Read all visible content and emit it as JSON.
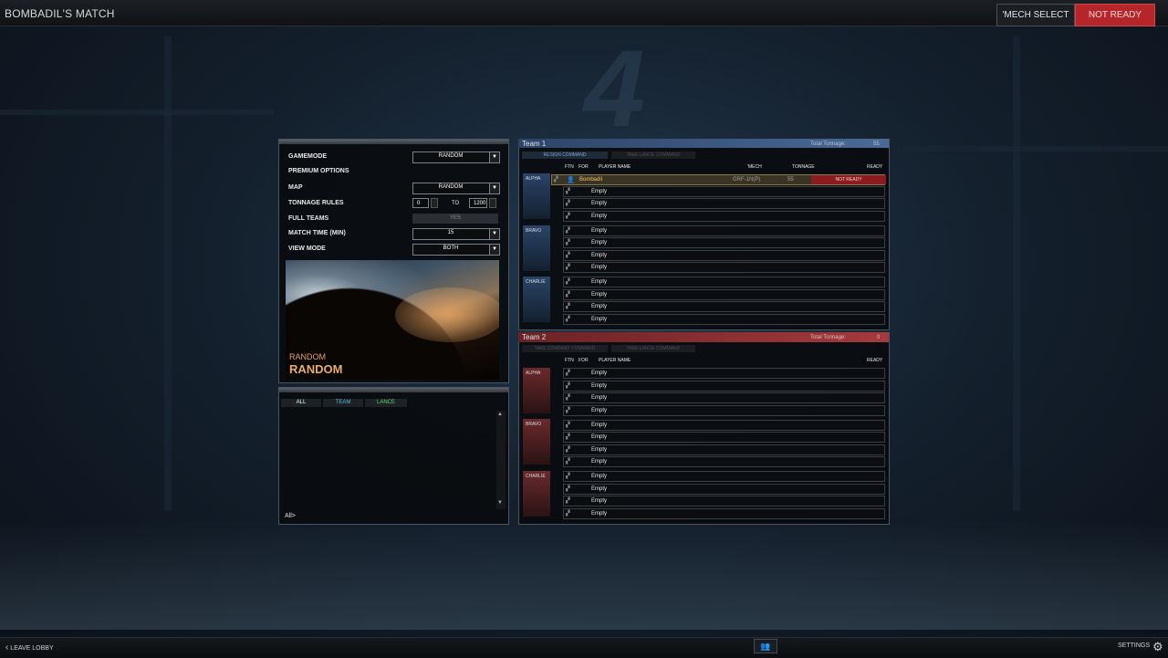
{
  "header": {
    "match_title": "BOMBADIL'S MATCH",
    "mech_select_label": "'MECH SELECT",
    "not_ready_label": "NOT READY"
  },
  "settings": {
    "gamemode_label": "GAMEMODE",
    "gamemode_value": "RANDOM",
    "premium_label": "PREMIUM OPTIONS",
    "map_label": "MAP",
    "map_value": "RANDOM",
    "tonnage_label": "TONNAGE RULES",
    "tonnage_min": "0",
    "tonnage_to": "TO",
    "tonnage_max": "1200",
    "full_teams_label": "FULL TEAMS",
    "full_teams_value": "YES",
    "match_time_label": "MATCH TIME (MIN)",
    "match_time_value": "15",
    "view_mode_label": "VIEW MODE",
    "view_mode_value": "BOTH",
    "map_preview_subtitle": "RANDOM",
    "map_preview_title": "RANDOM"
  },
  "chat": {
    "tabs": [
      "ALL",
      "TEAM",
      "LANCE"
    ],
    "input_prompt": "All>"
  },
  "team1": {
    "title": "Team 1",
    "tonnage_label": "Total Tonnage:",
    "tonnage_value": "55",
    "resign_label": "RESIGN COMMAND",
    "take_lance_label": "TAKE LANCE COMMAND",
    "col_ftn": "FTN",
    "col_for": "FOR",
    "col_player": "PLAYER NAME",
    "col_mech": "'MECH",
    "col_tonnage": "TONNAGE",
    "col_ready": "READY",
    "lances": [
      "ALPHA",
      "BRAVO",
      "CHARLIE"
    ],
    "player_name": "Bombadil",
    "player_mech": "GRF-1N(P)",
    "player_tonnage": "55",
    "player_ready": "NOT READY",
    "empty_label": "Empty"
  },
  "team2": {
    "title": "Team 2",
    "tonnage_label": "Total Tonnage:",
    "tonnage_value": "0",
    "take_company_label": "TAKE COMPANY COMMAND",
    "take_lance_label": "TAKE LANCE COMMAND",
    "col_ftn": "FTN",
    "col_for": "FOR",
    "col_player": "PLAYER NAME",
    "col_ready": "READY",
    "lances": [
      "ALPHA",
      "BRAVO",
      "CHARLIE"
    ],
    "empty_label": "Empty"
  },
  "footer": {
    "leave_label": "LEAVE LOBBY",
    "settings_label": "SETTINGS"
  },
  "colors": {
    "team1_accent": "#3b5a8a",
    "team2_accent": "#8a2a2a",
    "not_ready": "#b5262b"
  }
}
